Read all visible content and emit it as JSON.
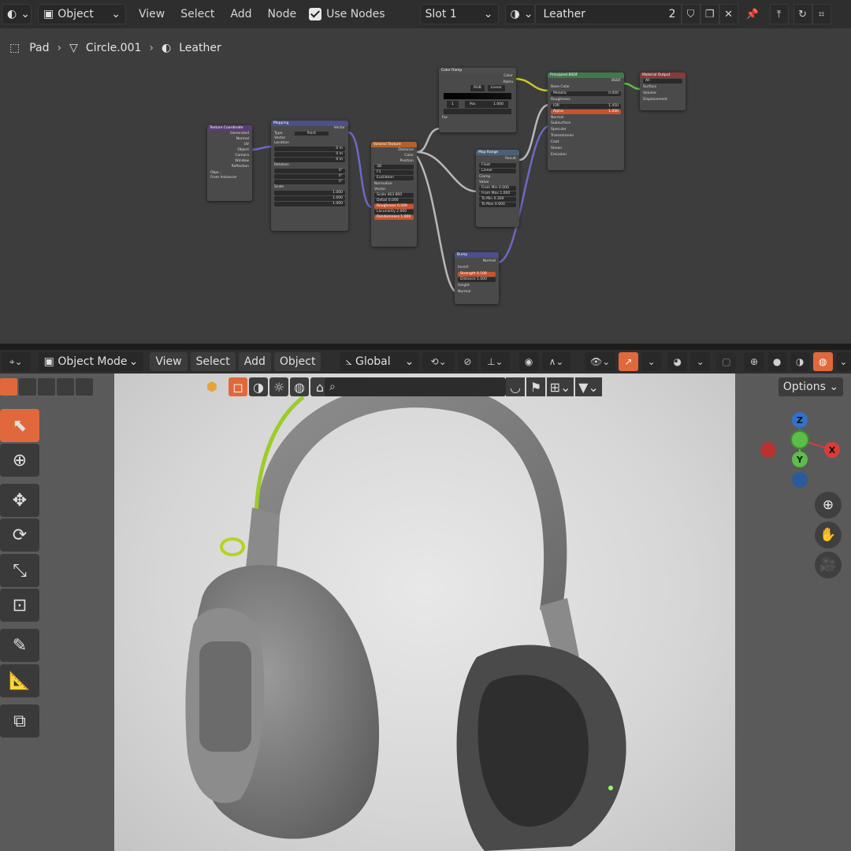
{
  "node_editor": {
    "header": {
      "editor_type": "Object",
      "menus": [
        "View",
        "Select",
        "Add",
        "Node"
      ],
      "use_nodes_label": "Use Nodes",
      "slot": "Slot 1",
      "material_name": "Leather",
      "users": "2"
    },
    "breadcrumb": [
      "Pad",
      "Circle.001",
      "Leather"
    ],
    "nodes": {
      "texcoord": {
        "title": "Texture Coordinate",
        "outputs": [
          "Generated",
          "Normal",
          "UV",
          "Object",
          "Camera",
          "Window",
          "Reflection"
        ],
        "object_label": "Obje...",
        "instancer": "From Instancer"
      },
      "mapping": {
        "title": "Mapping",
        "output": "Vector",
        "type_label": "Type",
        "type_value": "Point",
        "vector_label": "Vector",
        "location_label": "Location",
        "loc": [
          "0 m",
          "0 m",
          "0 m"
        ],
        "rotation_label": "Rotation",
        "rot": [
          "0°",
          "0°",
          "0°"
        ],
        "scale_label": "Scale",
        "scale": [
          "1.000",
          "1.000",
          "1.000"
        ]
      },
      "noise": {
        "title": "Voronoi Texture",
        "outputs": [
          "Distance",
          "Color",
          "Position"
        ],
        "dim": "3D",
        "feature": "F1",
        "metric": "Euclidean",
        "normalize": "Normalize",
        "vector": "Vector",
        "fields": [
          [
            "Scale",
            "463.800"
          ],
          [
            "Detail",
            "0.000"
          ],
          [
            "Roughness",
            "0.500"
          ],
          [
            "Lacunarity",
            "2.000"
          ],
          [
            "Randomness",
            "1.000"
          ]
        ]
      },
      "colorramp": {
        "title": "Color Ramp",
        "outputs": [
          "Color",
          "Alpha"
        ],
        "mode1": "RGB",
        "mode2": "Linear",
        "index": "1",
        "pos_label": "Pos",
        "pos": "1.000",
        "input": "Fac"
      },
      "maprange": {
        "title": "Map Range",
        "output": "Result",
        "type": "Float",
        "interp": "Linear",
        "clamp": "Clamp",
        "value": "Value",
        "fields": [
          [
            "From Min",
            "0.000"
          ],
          [
            "From Max",
            "1.000"
          ],
          [
            "To Min",
            "0.300"
          ],
          [
            "To Max",
            "0.600"
          ]
        ]
      },
      "bump": {
        "title": "Bump",
        "output": "Normal",
        "invert": "Invert",
        "fields": [
          [
            "Strength",
            "0.100"
          ],
          [
            "Distance",
            "1.000"
          ]
        ],
        "inputs": [
          "Height",
          "Normal"
        ]
      },
      "bsdf": {
        "title": "Principled BSDF",
        "output": "BSDF",
        "rows": [
          "Base Color",
          "Metallic",
          "Roughness",
          "IOR",
          "Alpha",
          "Normal",
          "Subsurface",
          "Specular",
          "Transmission",
          "Coat",
          "Sheen",
          "Emission"
        ],
        "metallic": "0.000",
        "ior": "1.450",
        "alpha": "1.000"
      },
      "output": {
        "title": "Material Output",
        "target": "All",
        "inputs": [
          "Surface",
          "Volume",
          "Displacement"
        ]
      }
    }
  },
  "viewport": {
    "header": {
      "mode": "Object Mode",
      "menus": [
        "View",
        "Select",
        "Add",
        "Object"
      ],
      "orientation": "Global"
    },
    "options_label": "Options",
    "gizmo": {
      "z": "Z",
      "y": "Y",
      "x": "X"
    },
    "colors": {
      "accent": "#e1683c",
      "x_axis": "#d93b3b",
      "y_axis": "#5cbd48",
      "z_axis": "#2f72c9"
    }
  }
}
